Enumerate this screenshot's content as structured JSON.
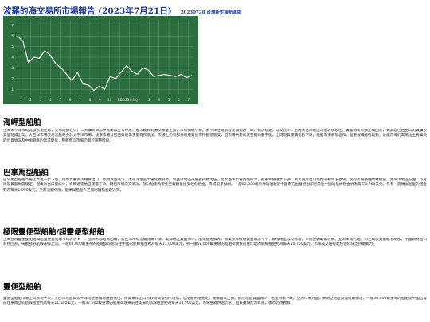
{
  "header": {
    "title": "波羅的海交易所市場報告 (2023年7月21日)",
    "subtitle": "20230728 台灣新生報航運版"
  },
  "chart_data": {
    "type": "line",
    "title": "",
    "xlabel": "",
    "ylabel": "",
    "categories": [
      "1",
      "2",
      "3",
      "4",
      "5",
      "6",
      "7",
      "8",
      "9",
      "10",
      "11",
      "2023年1月",
      "2",
      "3",
      "4",
      "5",
      "6",
      "7"
    ],
    "x_ticks": [
      "1",
      "2",
      "3",
      "4",
      "5",
      "6",
      "7",
      "8",
      "9",
      "10",
      "11",
      "2023年1月",
      "2",
      "3",
      "4",
      "5",
      "6",
      "7"
    ],
    "y_ticks": [
      "1",
      "2",
      "3",
      "4",
      "5",
      "6",
      "7"
    ],
    "ylim": [
      0.5,
      7.5
    ],
    "grid": true,
    "colors": {
      "background": "#2d6d40",
      "line": "#ffffff",
      "grid": "#5f9a72",
      "text": "#dce9de"
    },
    "series": [
      {
        "values": [
          6.0,
          5.5,
          3.5,
          4.0,
          3.9,
          4.6,
          4.2,
          3.4,
          3.0,
          2.4,
          1.8,
          2.6,
          1.5,
          1.4,
          0.9,
          1.3,
          1.0,
          2.2,
          2.0,
          2.6,
          3.2,
          2.7,
          2.4,
          3.0,
          2.8,
          2.2,
          2.3,
          2.4,
          2.3,
          2.2,
          2.4,
          2.1,
          2.3
        ]
      }
    ]
  },
  "sections": [
    {
      "heading": "海岬型船舶",
      "body": "上周太平洋市場運價表現走弱，交易活動較少，三大礦商目前中有兩家宣布停產，但未能夠刺激交易量上揚，市場情緒平穩。太平洋往返航程運價指數下跌，需求低迷，成交較少。上周大西洋地區運價表現較佳，貨盤增多帶動運價回升，尤其是巴西出口的鐵礦砂貨盤持續出現。大西洋市場交易活動略多於太平洋市場，遠東市場對巴西貨船需求量有所增加，市場上仍有部分船東對後市持觀望態度，但市場供需狀況整體尚屬平衡。上周現貨運價指數下跌，租船市場表現溫和，船東報價略有鬆動，後續市場仍需關注主要礦商的出貨情況及中國鋼廠的需求變化，整體而言市場仍處於調整階段。"
    },
    {
      "heading": "巴拿馬型船舶",
      "body": "巴拿馬型船舶市場上周進一步下跌，雨季影響南美糧食出口，穀物貨盤減少，太平洋地區市場延續弱勢，大西洋地區運價也持續走低。北大西洋市場貨盤稀少，船東報價逐步下調，南美東岸出口穀物運輸需求放緩，使得市場整體情緒偏空。太平洋地區方面，印尼煤炭貨盤尚屬穩定，但澳洲出口量減少，導致遠東地區運價下滑。期租市場成交清淡，部分船東為避免空載願意接受較低租金，市場競爭加劇。一艘82,000載重噸的船舶從中國南方出發經由印尼前往中國的航線租金約為每天8,750美元，另有一艘類似船型的租金約為每天1,000美元，交易活動有限，船東與租船人之間的價格差距仍大。"
    },
    {
      "heading": "極限靈便型船舶/超靈便型船舶",
      "body": "上周極限靈便型船舶與超靈便型船舶市場表現不一，亞洲市場略為回穩，大西洋市場運價持續下滑。美灣地區貨盤稀少，船東壓力加大，南美東岸穀物貨盤需求平平，歐陸地區成交有限，市場整體氣氛謹慎。亞洲市場方面，印尼煤炭貨盤略有增加，中國鋼材出口有所回升，帶動部分航線運價上漲。一艘63,000載重噸的船舶從印尼前往中國的航線租金約為每天11,000美元，另一艘58,000載重噸的船舶從遠東前往印度的航線租金約為每天10,750美元，市場成交略有起色但仍缺乏持續動力。"
    },
    {
      "heading": "靈便型船舶",
      "body": "靈便型船舶市場上周表現平淡，大西洋地區與太平洋地區運價均維持低位。南美東岸出口的穀物貨盤有所增加，但船舶供應充足，運價難以上揚。歐陸地區貨盤減少，租金持續下跌。亞洲市場方面，東南亞地區貨盤尚屬穩定，一艘38,000載重噸的船舶從中國出發前往東南亞的航線租金約為每天11,500美元，一艘37,000載重噸的船舶從遠東前往美灣的航線租金約為每天13,500美元，市場整體供過於求，船東議價能力有限，後市仍待觀察。"
    }
  ]
}
